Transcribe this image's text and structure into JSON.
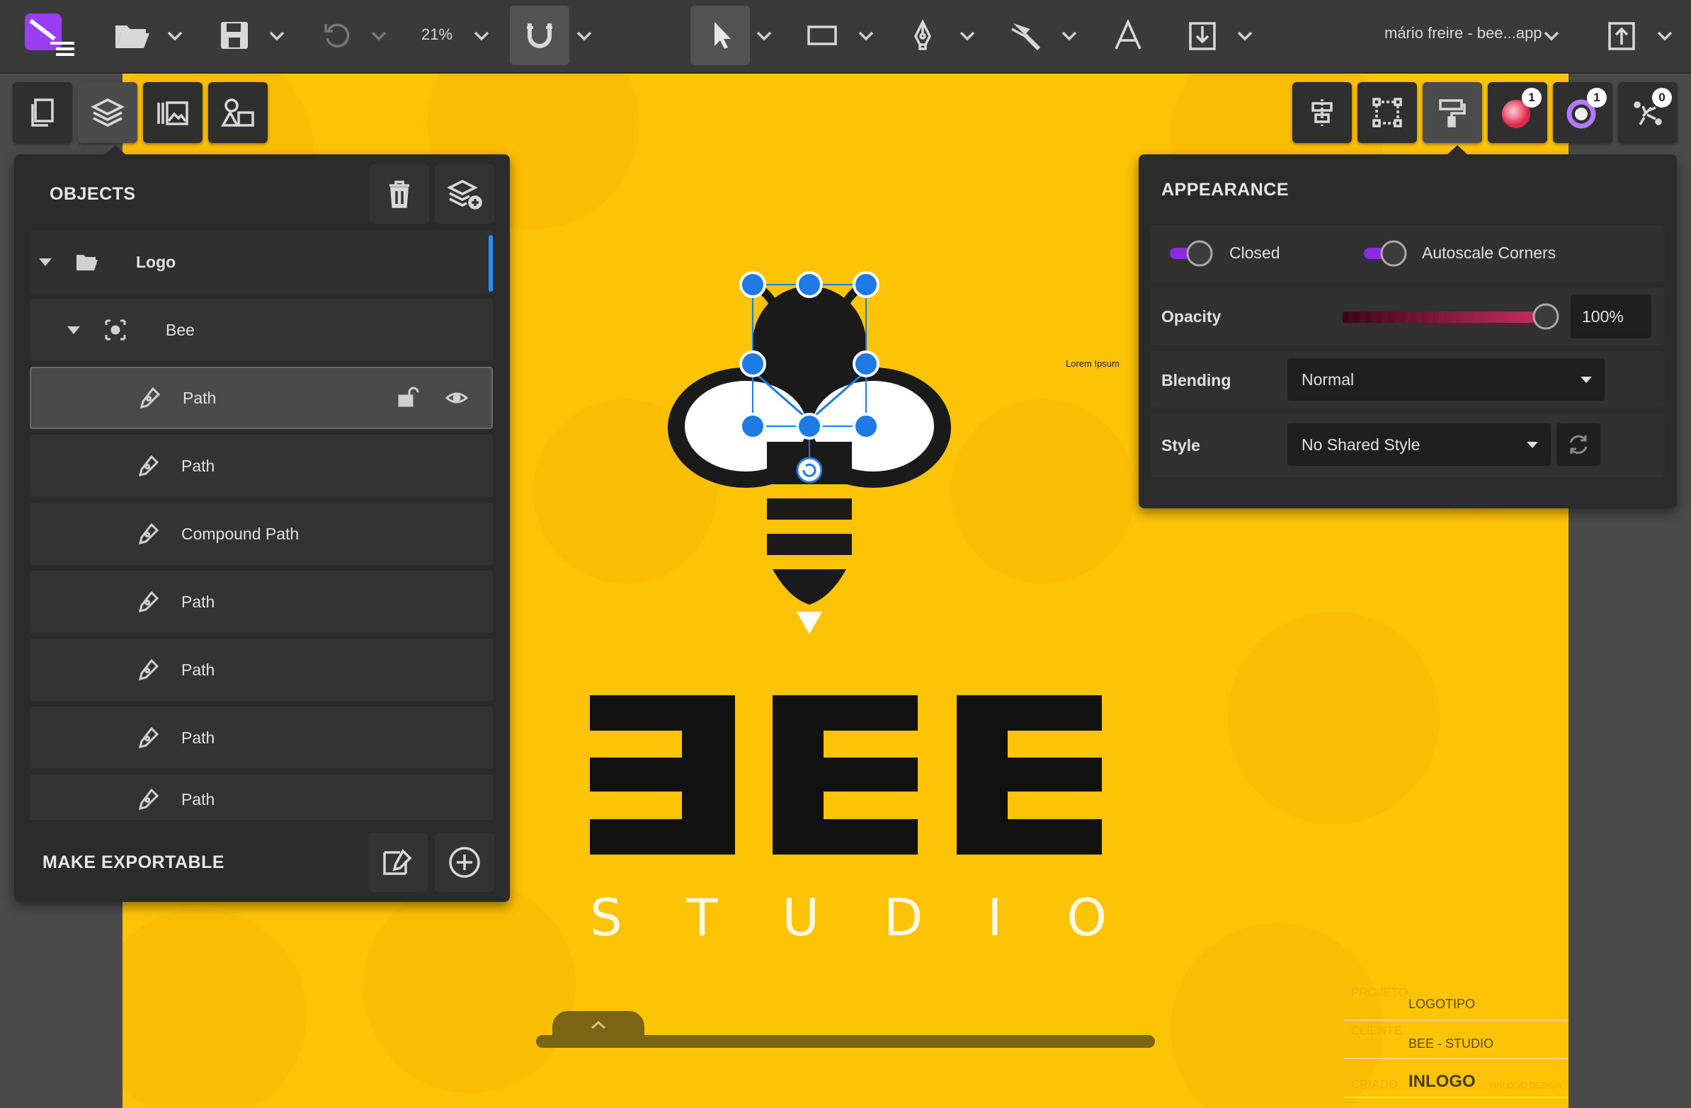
{
  "toolbar": {
    "zoom": "21%",
    "doc_title": "mário freire - bee...app",
    "icons": [
      "app-logo",
      "open-folder-icon",
      "save-icon",
      "undo-icon",
      "magnet-icon",
      "pointer-icon",
      "rectangle-icon",
      "pen-icon",
      "brush-icon",
      "text-icon",
      "import-icon",
      "export-icon"
    ]
  },
  "objects_panel": {
    "title": "OBJECTS",
    "layers": [
      {
        "label": "Logo",
        "kind": "folder"
      },
      {
        "label": "Bee",
        "kind": "group"
      },
      {
        "label": "Path",
        "kind": "path",
        "selected": true
      },
      {
        "label": "Path",
        "kind": "path"
      },
      {
        "label": "Compound Path",
        "kind": "path"
      },
      {
        "label": "Path",
        "kind": "path"
      },
      {
        "label": "Path",
        "kind": "path"
      },
      {
        "label": "Path",
        "kind": "path"
      },
      {
        "label": "Path",
        "kind": "path"
      }
    ],
    "make_exportable": "MAKE EXPORTABLE"
  },
  "appearance_panel": {
    "title": "APPEARANCE",
    "closed_label": "Closed",
    "autoscale_label": "Autoscale Corners",
    "opacity_label": "Opacity",
    "opacity_value": "100%",
    "blending_label": "Blending",
    "blending_value": "Normal",
    "style_label": "Style",
    "style_value": "No Shared Style"
  },
  "right_tools": {
    "fill_badge": "1",
    "stroke_badge": "1",
    "effects_badge": "0"
  },
  "canvas": {
    "lorem": "Lorem Ipsum",
    "logo_text": "BEE",
    "studio_letters": [
      "S",
      "T",
      "U",
      "D",
      "I",
      "O"
    ],
    "footer": {
      "row1_label": "PROJETO",
      "row1_value": "LOGOTIPO",
      "row2_label": "CLIENTE",
      "row2_value": "BEE - STUDIO",
      "row3_label": "CRIADO",
      "row3_brand": "INLOGO",
      "row3_sub": "#INLOGO DESIGN"
    }
  },
  "colors": {
    "canvas_yellow": "#fdc307",
    "selection_blue": "#1e7be6",
    "accent_purple": "#8a2be2"
  }
}
